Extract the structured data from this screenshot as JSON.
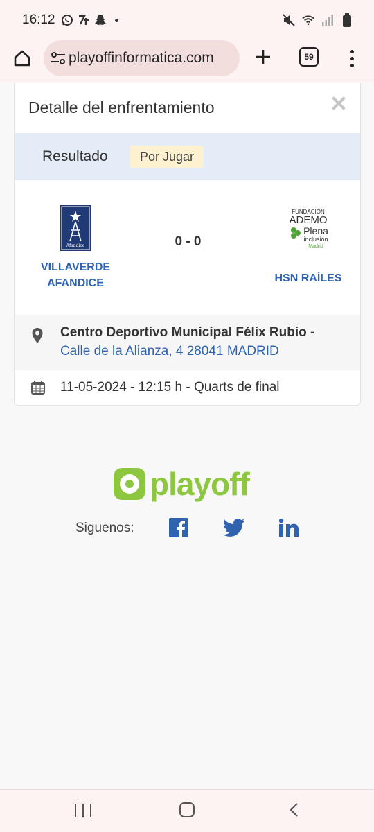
{
  "status": {
    "time": "16:12",
    "left_icons": [
      "whatsapp-icon",
      "app-icon",
      "snapchat-icon",
      "dot-icon"
    ],
    "right_icons": [
      "mute-icon",
      "wifi-icon",
      "signal-icon",
      "battery-icon"
    ]
  },
  "browser": {
    "url": "playoffinformatica.com",
    "tab_count": "59",
    "icons": [
      "home-icon",
      "tune-icon",
      "plus-icon",
      "tabs-icon",
      "more-vert-icon"
    ]
  },
  "match": {
    "title": "Detalle del enfrentamiento",
    "result_label": "Resultado",
    "status_badge": "Por Jugar",
    "home_team": {
      "line1": "VILLAVERDE",
      "line2": "AFANDICE",
      "logo_text": "Afandice"
    },
    "away_team": {
      "name": "HSN RAÍLES",
      "logo_line1": "FUNDACIÓN",
      "logo_line2": "ADEMO",
      "logo_line3": "Plena",
      "logo_line4": "inclusión",
      "logo_line5": "Madrid"
    },
    "score": "0 - 0",
    "venue_name": "Centro Deportivo Municipal Félix Rubio -",
    "venue_address": "Calle de la Alianza, 4 28041 MADRID",
    "datetime": "11-05-2024 - 12:15 h - Quarts de final",
    "colors": {
      "link": "#2f63b0",
      "badge_bg": "#fdf1cf",
      "result_bg": "#e4ecf7"
    }
  },
  "footer": {
    "brand": "playoff",
    "follow_label": "Siguenos:",
    "social": [
      "facebook-icon",
      "twitter-icon",
      "linkedin-icon"
    ],
    "colors": {
      "brand": "#8dc63f",
      "social": "#2f63b0"
    }
  }
}
